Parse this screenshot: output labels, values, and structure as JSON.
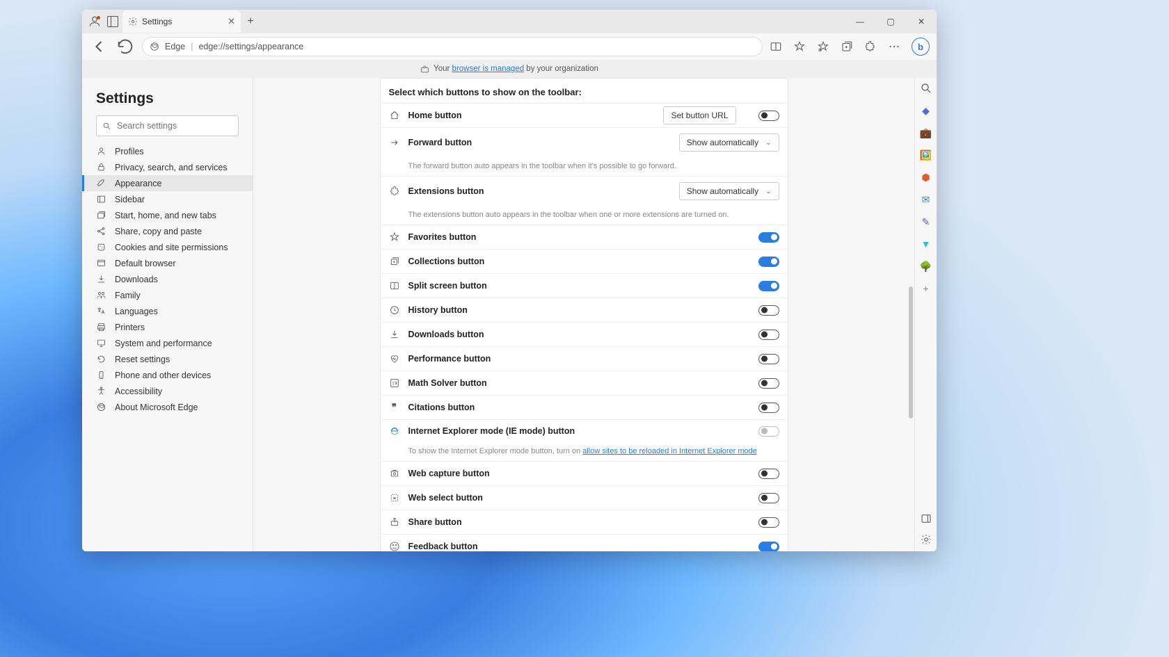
{
  "tab": {
    "title": "Settings"
  },
  "address": {
    "app": "Edge",
    "url": "edge://settings/appearance"
  },
  "managed": {
    "prefix": "Your ",
    "link": "browser is managed",
    "suffix": " by your organization"
  },
  "sidebar": {
    "title": "Settings",
    "search_placeholder": "Search settings",
    "items": [
      {
        "label": "Profiles"
      },
      {
        "label": "Privacy, search, and services"
      },
      {
        "label": "Appearance"
      },
      {
        "label": "Sidebar"
      },
      {
        "label": "Start, home, and new tabs"
      },
      {
        "label": "Share, copy and paste"
      },
      {
        "label": "Cookies and site permissions"
      },
      {
        "label": "Default browser"
      },
      {
        "label": "Downloads"
      },
      {
        "label": "Family"
      },
      {
        "label": "Languages"
      },
      {
        "label": "Printers"
      },
      {
        "label": "System and performance"
      },
      {
        "label": "Reset settings"
      },
      {
        "label": "Phone and other devices"
      },
      {
        "label": "Accessibility"
      },
      {
        "label": "About Microsoft Edge"
      }
    ]
  },
  "card": {
    "title": "Select which buttons to show on the toolbar:",
    "set_button_url": "Set button URL",
    "show_auto": "Show automatically",
    "rows": {
      "home": {
        "label": "Home button"
      },
      "forward": {
        "label": "Forward button",
        "desc": "The forward button auto appears in the toolbar when it's possible to go forward."
      },
      "extensions": {
        "label": "Extensions button",
        "desc": "The extensions button auto appears in the toolbar when one or more extensions are turned on."
      },
      "favorites": {
        "label": "Favorites button"
      },
      "collections": {
        "label": "Collections button"
      },
      "split": {
        "label": "Split screen button"
      },
      "history": {
        "label": "History button"
      },
      "downloads": {
        "label": "Downloads button"
      },
      "performance": {
        "label": "Performance button"
      },
      "math": {
        "label": "Math Solver button"
      },
      "citations": {
        "label": "Citations button"
      },
      "ie": {
        "label": "Internet Explorer mode (IE mode) button",
        "desc_pre": "To show the Internet Explorer mode button, turn on ",
        "desc_link": "allow sites to be reloaded in Internet Explorer mode"
      },
      "capture": {
        "label": "Web capture button"
      },
      "select": {
        "label": "Web select button"
      },
      "share": {
        "label": "Share button"
      },
      "feedback": {
        "label": "Feedback button"
      }
    }
  }
}
